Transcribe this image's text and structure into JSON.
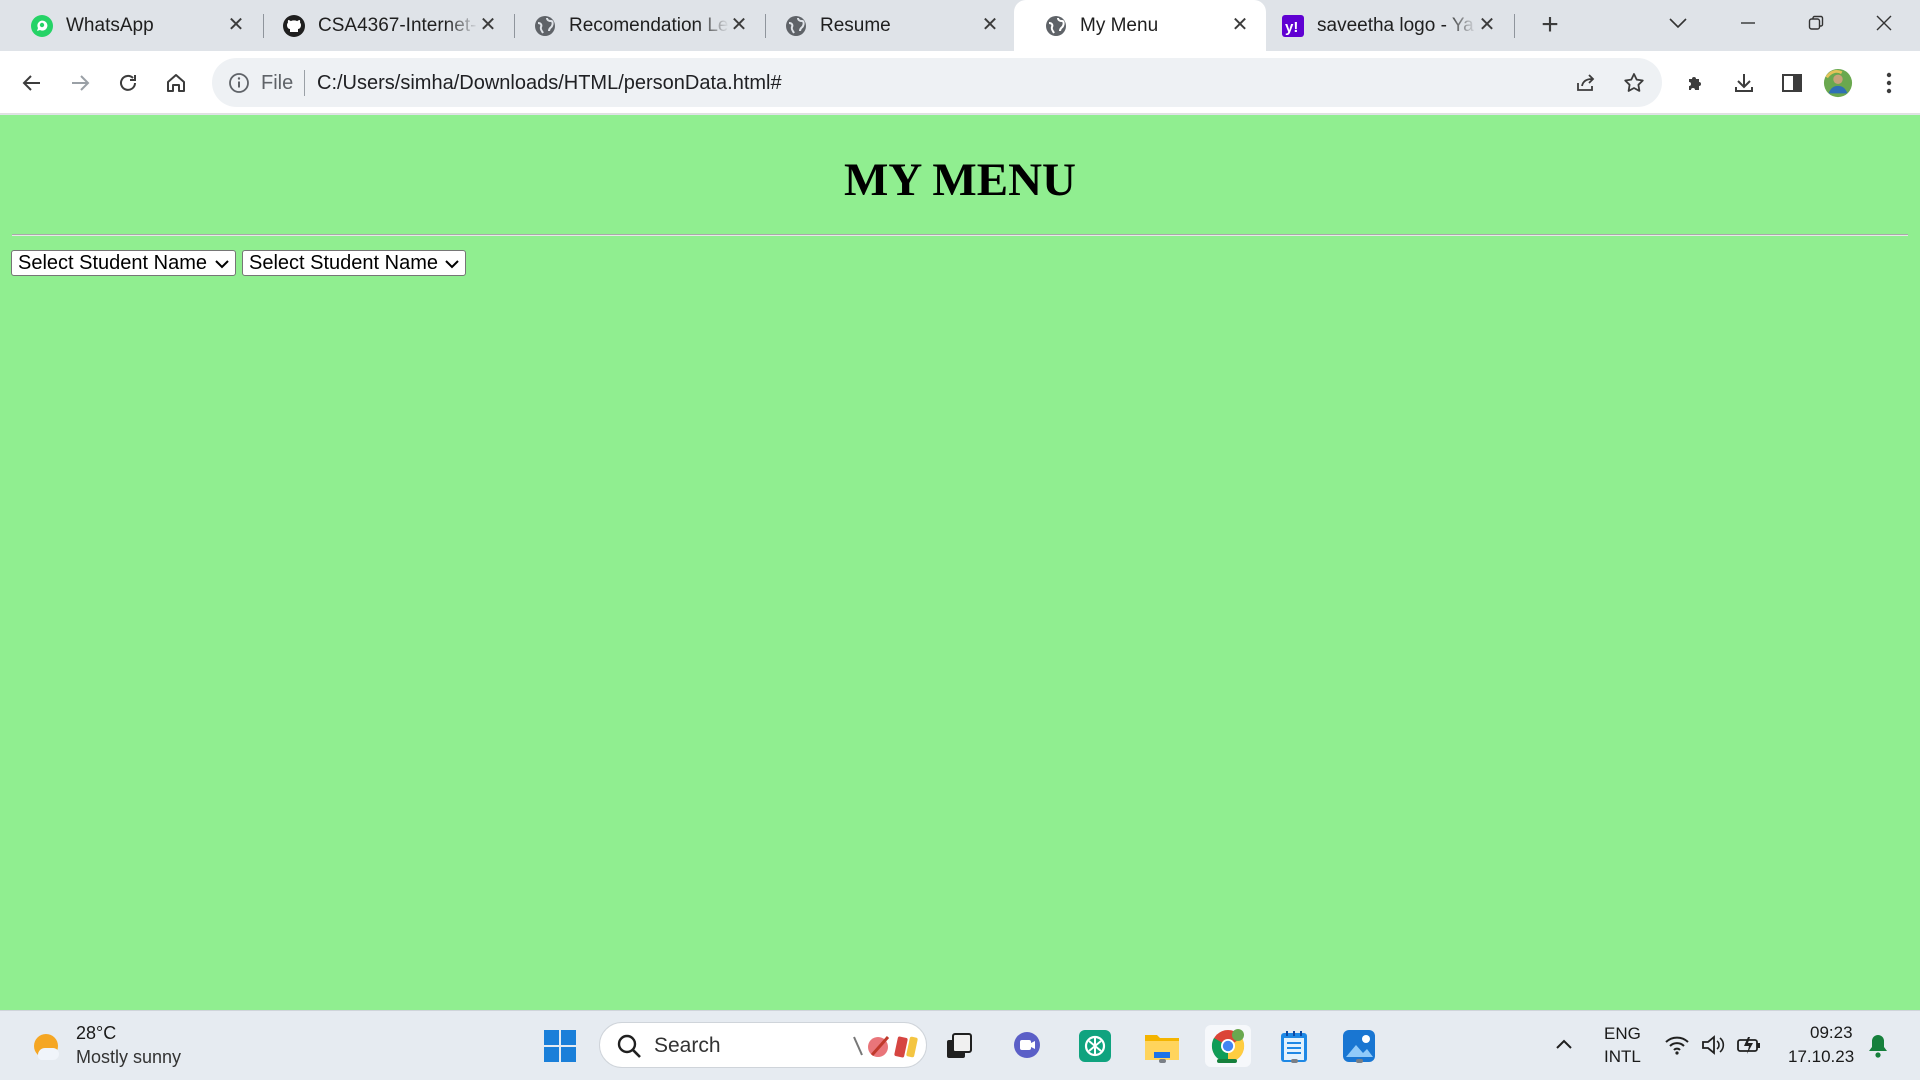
{
  "browser": {
    "tabs": [
      {
        "title": "WhatsApp",
        "icon": "whatsapp-icon",
        "active": false
      },
      {
        "title": "CSA4367-Internet-",
        "icon": "github-icon",
        "active": false
      },
      {
        "title": "Recomendation Le",
        "icon": "globe-icon",
        "active": false
      },
      {
        "title": "Resume",
        "icon": "globe-icon",
        "active": false
      },
      {
        "title": "My Menu",
        "icon": "globe-icon",
        "active": true
      },
      {
        "title": "saveetha logo - Ya",
        "icon": "yahoo-icon",
        "active": false
      }
    ],
    "new_tab_label": "+",
    "address": {
      "scheme": "File",
      "url": "C:/Users/simha/Downloads/HTML/personData.html#"
    }
  },
  "page": {
    "heading": "MY MENU",
    "selects": [
      {
        "selected": "Select Student Name"
      },
      {
        "selected": "Select Student Name"
      }
    ],
    "background": "#90ee90"
  },
  "taskbar": {
    "weather": {
      "temp": "28°C",
      "desc": "Mostly sunny"
    },
    "search_placeholder": "Search",
    "language": {
      "line1": "ENG",
      "line2": "INTL"
    },
    "clock": {
      "time": "09:23",
      "date": "17.10.23"
    }
  },
  "colors": {
    "accent_green": "#16803c",
    "page_green": "#90ee90",
    "whatsapp": "#25d366",
    "yahoo": "#6001d2"
  }
}
